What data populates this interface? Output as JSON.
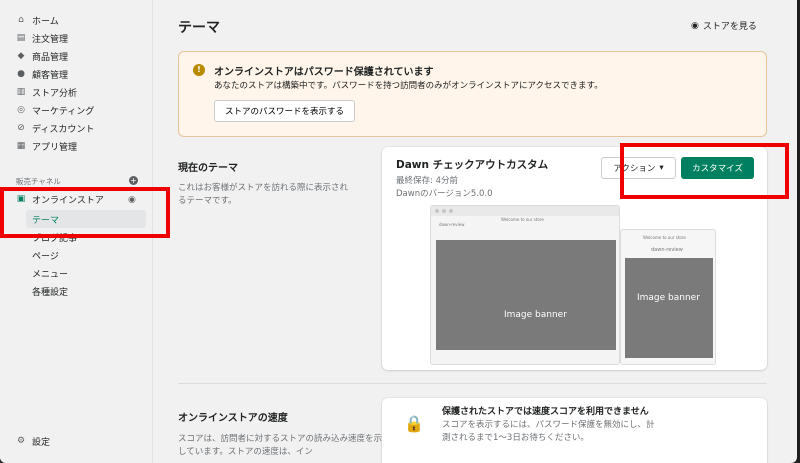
{
  "sidebar": {
    "items": [
      {
        "label": "ホーム",
        "icon": "home-icon"
      },
      {
        "label": "注文管理",
        "icon": "orders-icon"
      },
      {
        "label": "商品管理",
        "icon": "tag-icon"
      },
      {
        "label": "顧客管理",
        "icon": "customers-icon"
      },
      {
        "label": "ストア分析",
        "icon": "analytics-icon"
      },
      {
        "label": "マーケティング",
        "icon": "marketing-icon"
      },
      {
        "label": "ディスカウント",
        "icon": "discount-icon"
      },
      {
        "label": "アプリ管理",
        "icon": "apps-icon"
      }
    ],
    "sales_channels_label": "販売チャネル",
    "online_store": "オンラインストア",
    "subitems": [
      "テーマ",
      "ブログ記事",
      "ページ",
      "メニュー",
      "各種設定"
    ],
    "settings": "設定"
  },
  "header": {
    "title": "テーマ",
    "view_store": "ストアを見る"
  },
  "banner": {
    "title": "オンラインストアはパスワード保護されています",
    "text": "あなたのストアは構築中です。パスワードを持つ訪問者のみがオンラインストアにアクセスできます。",
    "button": "ストアのパスワードを表示する"
  },
  "current_theme": {
    "section_title": "現在のテーマ",
    "section_desc": "これはお客様がストアを訪れる際に表示されるテーマです。",
    "name": "Dawn チェックアウトカスタム",
    "saved": "最終保存: 4分前",
    "version": "Dawnのバージョン5.0.0",
    "action_label": "アクション",
    "customize_label": "カスタマイズ",
    "preview_banner": "Image banner",
    "preview_store": "dawn-review",
    "preview_welcome": "Welcome to our store"
  },
  "speed": {
    "section_title": "オンラインストアの速度",
    "section_desc": "スコアは、訪問者に対するストアの読み込み速度を示しています。ストアの速度は、イン",
    "card_title": "保護されたストアでは速度スコアを利用できません",
    "card_text": "スコアを表示するには、パスワード保護を無効にし、計測されるまで1〜3日お待ちください。"
  },
  "colors": {
    "accent": "#008060",
    "highlight": "#ee0000",
    "banner_bg": "#fff5ea"
  }
}
